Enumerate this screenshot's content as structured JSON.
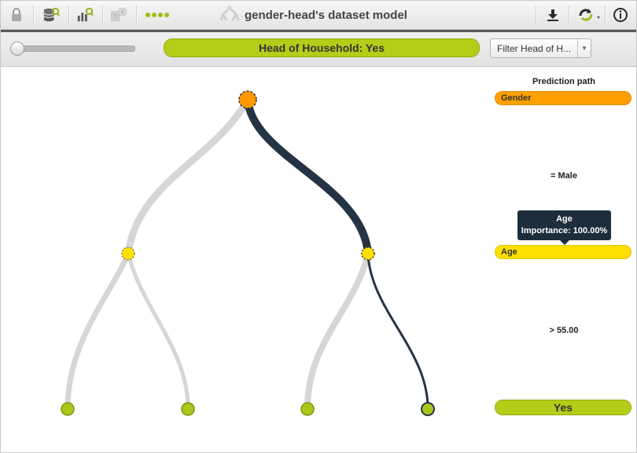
{
  "window": {
    "title": "gender-head's dataset model"
  },
  "toolbar": {
    "icons": [
      "lock-icon",
      "dataset-search-icon",
      "chart-search-icon",
      "list-badge-icon",
      "dots-icon",
      "download-icon",
      "reload-icon",
      "info-icon"
    ],
    "badge_count": "0"
  },
  "prediction": {
    "label": "Head of Household: Yes"
  },
  "filter": {
    "value": "Filter Head of H..."
  },
  "path": {
    "title": "Prediction path",
    "steps": [
      {
        "field": "Gender",
        "color": "#ffa000",
        "condition": "= Male"
      },
      {
        "field": "Age",
        "color": "#ffe000",
        "condition": "> 55.00"
      }
    ],
    "result": "Yes",
    "result_color": "#b5cc18"
  },
  "tooltip": {
    "title": "Age",
    "text": "Importance: 100.00%"
  },
  "colors": {
    "root_node": "#ff9900",
    "split_node": "#ffe000",
    "leaf_node": "#a9c61a",
    "branch_default": "#d6d6d6",
    "branch_active": "#253444"
  }
}
